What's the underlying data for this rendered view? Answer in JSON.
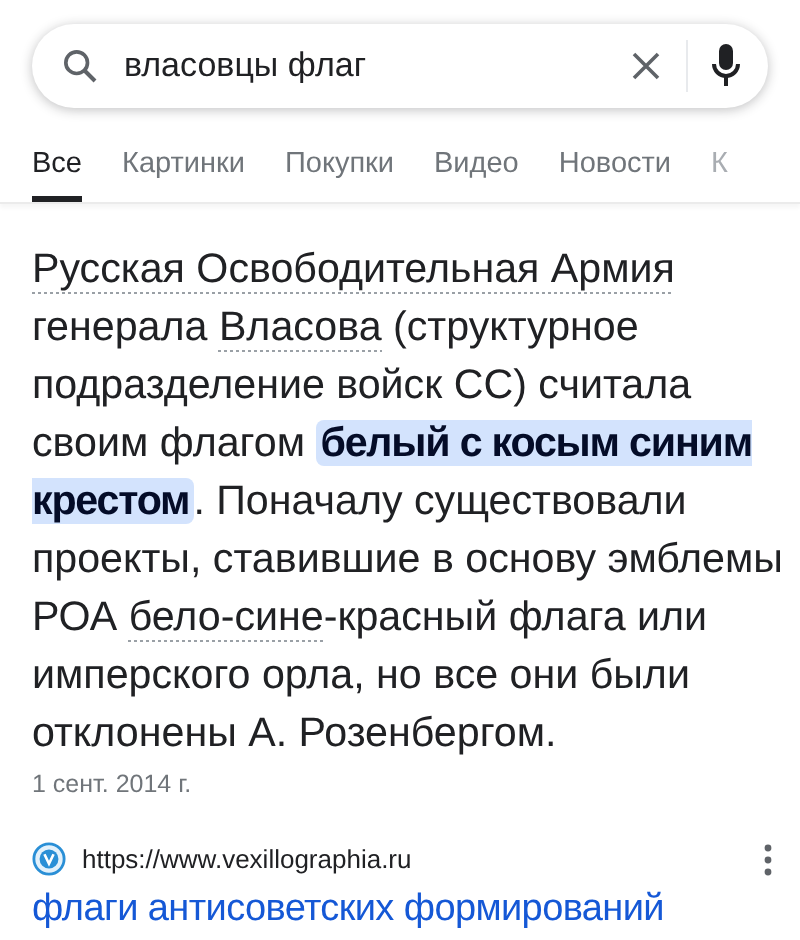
{
  "search": {
    "value": "власовцы флаг"
  },
  "tabs": [
    {
      "label": "Все",
      "selected": true
    },
    {
      "label": "Картинки",
      "selected": false
    },
    {
      "label": "Покупки",
      "selected": false
    },
    {
      "label": "Видео",
      "selected": false
    },
    {
      "label": "Новости",
      "selected": false
    },
    {
      "label": "К",
      "selected": false
    }
  ],
  "snippet": {
    "segments": [
      {
        "kind": "term",
        "text": "Русская Освободительная Армия"
      },
      {
        "kind": "text",
        "text": " генерала "
      },
      {
        "kind": "term",
        "text": "Власова"
      },
      {
        "kind": "text",
        "text": " (структурное подразделение войск СС) считала своим флагом "
      },
      {
        "kind": "highlight",
        "text": "белый с косым синим крестом"
      },
      {
        "kind": "text",
        "text": ". Поначалу существовали проекты, ставившие в основу эмблемы РОА "
      },
      {
        "kind": "term",
        "text": "бело-сине"
      },
      {
        "kind": "text",
        "text": "-красный флага или имперского орла, но все они были отклонены А. Розенбергом."
      }
    ],
    "date": "1 сент. 2014 г."
  },
  "result": {
    "url": "https://www.vexillographia.ru",
    "title": "флаги антисоветских формирований"
  }
}
